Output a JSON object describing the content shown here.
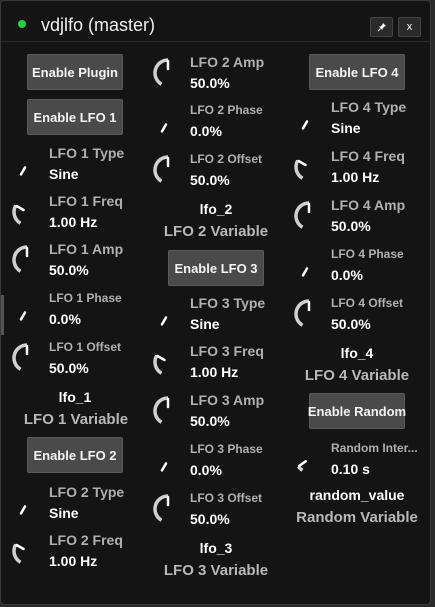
{
  "window": {
    "title": "vdjlfo (master)",
    "pin_icon": "pin-icon",
    "close_label": "x"
  },
  "buttons": {
    "enable_plugin": "Enable Plugin",
    "enable_lfo1": "Enable LFO 1",
    "enable_lfo2": "Enable LFO 2",
    "enable_lfo3": "Enable LFO 3",
    "enable_lfo4": "Enable LFO 4",
    "enable_random": "Enable Random"
  },
  "lfo1": {
    "type": {
      "label": "LFO 1 Type",
      "value": "Sine"
    },
    "freq": {
      "label": "LFO 1 Freq",
      "value": "1.00 Hz"
    },
    "amp": {
      "label": "LFO 1 Amp",
      "value": "50.0%"
    },
    "phase": {
      "label": "LFO 1 Phase",
      "value": "0.0%"
    },
    "offset": {
      "label": "LFO 1 Offset",
      "value": "50.0%"
    },
    "var_name": "lfo_1",
    "var_desc": "LFO 1 Variable"
  },
  "lfo2": {
    "type": {
      "label": "LFO 2 Type",
      "value": "Sine"
    },
    "freq": {
      "label": "LFO 2 Freq",
      "value": "1.00 Hz"
    },
    "amp": {
      "label": "LFO 2 Amp",
      "value": "50.0%"
    },
    "phase": {
      "label": "LFO 2 Phase",
      "value": "0.0%"
    },
    "offset": {
      "label": "LFO 2 Offset",
      "value": "50.0%"
    },
    "var_name": "lfo_2",
    "var_desc": "LFO 2 Variable"
  },
  "lfo3": {
    "type": {
      "label": "LFO 3 Type",
      "value": "Sine"
    },
    "freq": {
      "label": "LFO 3 Freq",
      "value": "1.00 Hz"
    },
    "amp": {
      "label": "LFO 3 Amp",
      "value": "50.0%"
    },
    "phase": {
      "label": "LFO 3 Phase",
      "value": "0.0%"
    },
    "offset": {
      "label": "LFO 3 Offset",
      "value": "50.0%"
    },
    "var_name": "lfo_3",
    "var_desc": "LFO 3 Variable"
  },
  "lfo4": {
    "type": {
      "label": "LFO 4 Type",
      "value": "Sine"
    },
    "freq": {
      "label": "LFO 4 Freq",
      "value": "1.00 Hz"
    },
    "amp": {
      "label": "LFO 4 Amp",
      "value": "50.0%"
    },
    "phase": {
      "label": "LFO 4 Phase",
      "value": "0.0%"
    },
    "offset": {
      "label": "LFO 4 Offset",
      "value": "50.0%"
    },
    "var_name": "lfo_4",
    "var_desc": "LFO 4 Variable"
  },
  "random": {
    "interval": {
      "label": "Random Inter...",
      "value": "0.10 s"
    },
    "var_name": "random_value",
    "var_desc": "Random Variable"
  },
  "colors": {
    "status_dot": "#21d244",
    "background": "#141414",
    "button": "#4a4a4a"
  }
}
